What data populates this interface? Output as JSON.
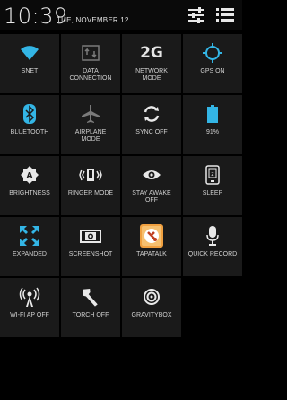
{
  "header": {
    "time": "10:39",
    "date": "TUE, NOVEMBER 12"
  },
  "colors": {
    "accent_blue": "#33b5e5",
    "tile_bg": "#1a1a1a",
    "gray_icon": "#7a7a7a",
    "white_icon": "#e8e8e8"
  },
  "tiles": [
    {
      "label": "SNET",
      "icon": "wifi-icon"
    },
    {
      "label": "DATA\nCONNECTION",
      "icon": "data-connection-icon"
    },
    {
      "label": "NETWORK\nMODE",
      "icon": "network-mode-icon",
      "icon_text": "2G"
    },
    {
      "label": "GPS ON",
      "icon": "gps-icon"
    },
    {
      "label": "BLUETOOTH",
      "icon": "bluetooth-icon"
    },
    {
      "label": "AIRPLANE\nMODE",
      "icon": "airplane-icon"
    },
    {
      "label": "SYNC OFF",
      "icon": "sync-icon"
    },
    {
      "label": "91%",
      "icon": "battery-icon"
    },
    {
      "label": "BRIGHTNESS",
      "icon": "brightness-icon"
    },
    {
      "label": "RINGER MODE",
      "icon": "ringer-icon"
    },
    {
      "label": "STAY AWAKE\nOFF",
      "icon": "eye-icon"
    },
    {
      "label": "SLEEP",
      "icon": "sleep-icon"
    },
    {
      "label": "EXPANDED",
      "icon": "expand-icon"
    },
    {
      "label": "SCREENSHOT",
      "icon": "camera-icon"
    },
    {
      "label": "TAPATALK",
      "icon": "tapatalk-icon"
    },
    {
      "label": "QUICK RECORD",
      "icon": "microphone-icon"
    },
    {
      "label": "WI-FI AP OFF",
      "icon": "wifi-ap-icon"
    },
    {
      "label": "TORCH OFF",
      "icon": "torch-icon"
    },
    {
      "label": "GRAVITYBOX",
      "icon": "gravitybox-icon"
    }
  ]
}
